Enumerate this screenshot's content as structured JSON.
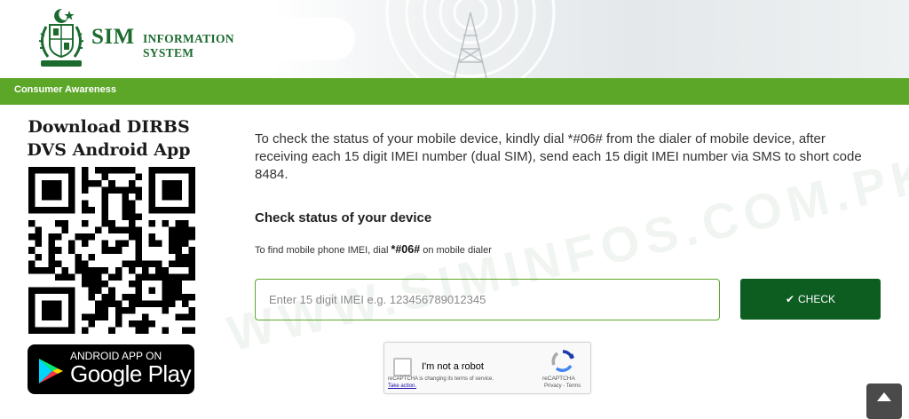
{
  "header": {
    "brand_sim": "SIM",
    "brand_information": "INFORMATION",
    "brand_system": "SYSTEM"
  },
  "nav": {
    "label": "Consumer Awareness"
  },
  "sidebar": {
    "title_line1": "Download DIRBS",
    "title_line2": "DVS Android App",
    "store_top": "ANDROID APP ON",
    "store_name": "Google Play"
  },
  "main": {
    "intro": "To check the status of your mobile device, kindly dial *#06# from the dialer of mobile device, after receiving each 15 digit IMEI number (dual SIM), send each 15 digit IMEI number via SMS to short code 8484.",
    "section_title": "Check status of your device",
    "hint_prefix": "To find mobile phone IMEI, dial ",
    "hint_code": "*#06#",
    "hint_suffix": " on mobile dialer",
    "imei_placeholder": "Enter 15 digit IMEI e.g. 123456789012345",
    "imei_value": "",
    "check_label": "CHECK",
    "watermark": "WWW.SIMINFOS.COM.PK"
  },
  "captcha": {
    "label": "I'm not a robot",
    "note": "reCAPTCHA is changing its terms of service.",
    "take_action": "Take action.",
    "brand": "reCAPTCHA",
    "links": "Privacy - Terms"
  },
  "colors": {
    "brand_green": "#1b6b2f",
    "nav_green": "#5ca728",
    "button_green": "#0d5d21"
  }
}
